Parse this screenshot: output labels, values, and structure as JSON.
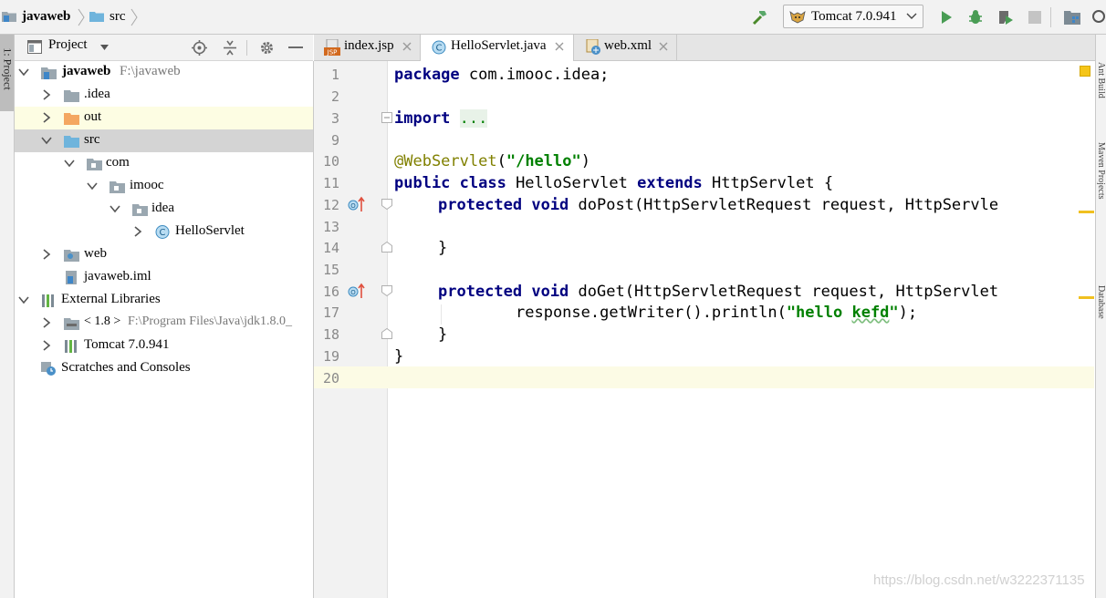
{
  "breadcrumb": {
    "items": [
      "javaweb",
      "src"
    ]
  },
  "toolbar": {
    "run_config": "Tomcat 7.0.941",
    "buttons": [
      "build-hammer-icon",
      "run-icon",
      "debug-icon",
      "coverage-icon",
      "stop-icon",
      "project-structure-icon",
      "search-icon"
    ]
  },
  "left_stripe": {
    "tab_label": "1: Project"
  },
  "project_panel": {
    "title": "Project",
    "tree": [
      {
        "label": "javaweb",
        "path": "F:\\javaweb",
        "bold": true
      },
      {
        "label": ".idea"
      },
      {
        "label": "out"
      },
      {
        "label": "src"
      },
      {
        "label": "com"
      },
      {
        "label": "imooc"
      },
      {
        "label": "idea"
      },
      {
        "label": "HelloServlet"
      },
      {
        "label": "web"
      },
      {
        "label": "javaweb.iml"
      },
      {
        "label": "External Libraries"
      },
      {
        "label": "< 1.8 >",
        "path": "F:\\Program Files\\Java\\jdk1.8.0_"
      },
      {
        "label": "Tomcat 7.0.941"
      },
      {
        "label": "Scratches and Consoles"
      }
    ]
  },
  "editor_tabs": [
    {
      "label": "index.jsp",
      "active": false
    },
    {
      "label": "HelloServlet.java",
      "active": true
    },
    {
      "label": "web.xml",
      "active": false
    }
  ],
  "editor": {
    "line_numbers": [
      "1",
      "2",
      "3",
      "9",
      "10",
      "11",
      "12",
      "13",
      "14",
      "15",
      "16",
      "17",
      "18",
      "19",
      "20"
    ],
    "code": {
      "l1_kw": "package",
      "l1_rest": " com.imooc.idea;",
      "l3_kw": "import",
      "l3_fold": "...",
      "l10_ann": "@WebServlet",
      "l10_open": "(",
      "l10_str": "\"/hello\"",
      "l10_close": ")",
      "l11_kw1": "public class",
      "l11_mid": " HelloServlet ",
      "l11_kw2": "extends",
      "l11_rest": " HttpServlet {",
      "l12_kw": "protected void",
      "l12_rest": " doPost(HttpServletRequest request, HttpServle",
      "l14_text": "}",
      "l16_kw": "protected void",
      "l16_rest": " doGet(HttpServletRequest request, HttpServlet",
      "l17_pre": "response.getWriter().println(",
      "l17_str1": "\"hello ",
      "l17_str2": "kefd",
      "l17_str3": "\"",
      "l17_post": ");",
      "l18_text": "}",
      "l19_text": "}"
    }
  },
  "right_stripe": {
    "labels": [
      "Ant Build",
      "Maven Projects",
      "Database"
    ]
  },
  "watermark": "https://blog.csdn.net/w3222371135",
  "colors": {
    "keyword": "#000080",
    "annotation": "#808000",
    "string": "#008000",
    "selection_row": "#d4d4d4",
    "excluded_row": "#fdfde3",
    "caret_line": "#fcfbe5"
  }
}
